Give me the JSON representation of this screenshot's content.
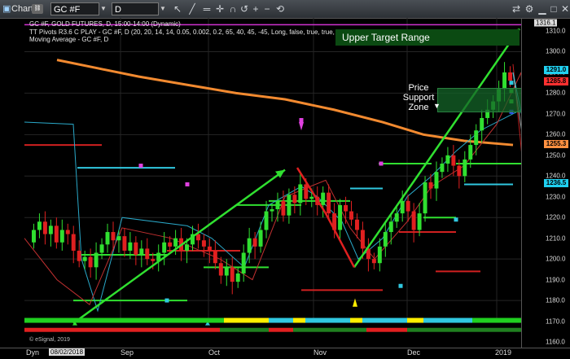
{
  "toolbar": {
    "chart_label": "Chart",
    "symbol": "GC #F",
    "interval": "D"
  },
  "info_lines": [
    "GC #F, GOLD FUTURES, D, 15:00-14:00 (Dynamic)",
    "TT Pivots R3.6 C PLAY - GC #F, D (20, 20, 14, 14, 0.05, 0.002, 0.2, 65, 40, 45, -45, Long, false, true, true, 7)",
    "Moving Average - GC #F, D"
  ],
  "annotations": {
    "upper_target": "Upper Target Range",
    "price_support": [
      "Price",
      "Support",
      "Zone"
    ]
  },
  "y_axis": {
    "ticks": [
      "1310.0",
      "1300.0",
      "1290.0",
      "1280.0",
      "1270.0",
      "1260.0",
      "1250.0",
      "1240.0",
      "1230.0",
      "1220.0",
      "1210.0",
      "1200.0",
      "1190.0",
      "1180.0",
      "1170.0",
      "1160.0"
    ],
    "top_label": "1316.1"
  },
  "price_tags": [
    {
      "label": "1291.0",
      "color": "#20d0f0",
      "value": 1291.0
    },
    {
      "label": "1285.8",
      "color": "#ff3030",
      "value": 1285.8
    },
    {
      "label": "1255.3",
      "color": "#ff9040",
      "value": 1255.3
    },
    {
      "label": "1236.5",
      "color": "#20d0f0",
      "value": 1236.5
    }
  ],
  "x_axis": {
    "ticks": [
      "Sep",
      "Oct",
      "Nov",
      "Dec",
      "2019"
    ],
    "interval_label": "Dyn",
    "date_label": "08/02/2018"
  },
  "watermark": "© eSignal, 2019"
}
